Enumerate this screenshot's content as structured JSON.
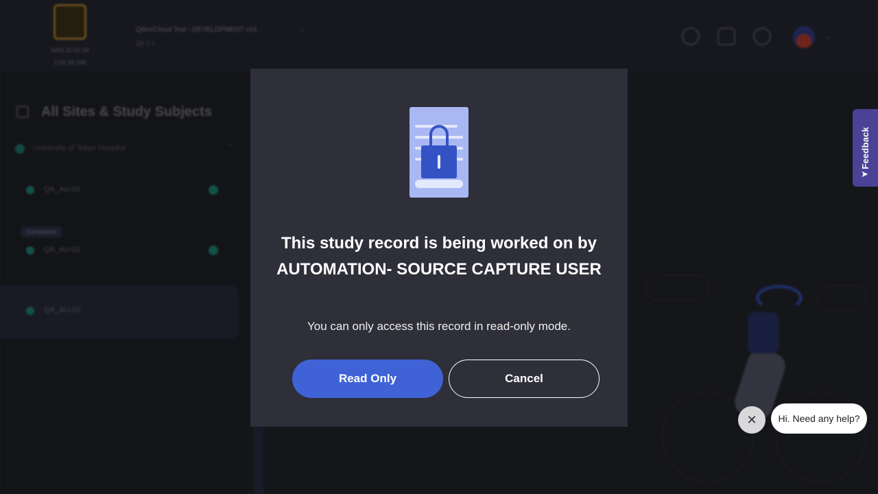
{
  "header": {
    "logo_caption_1": "SAN 11:01:34",
    "logo_caption_2": "1:01:34 GM",
    "study_name": "Qilen/Cloud Test - DEVELOPMENT v16",
    "study_sub": "Qtr 1.1",
    "icons": [
      "search-icon",
      "bell-icon",
      "help-icon"
    ]
  },
  "sidebar": {
    "title": "All Sites & Study Subjects",
    "site_name": "University of Tokyo Hospital",
    "subjects": [
      {
        "label": "QA_AU-01",
        "active": false
      },
      {
        "label": "QA_AU-02",
        "active": false,
        "badge": "Completed"
      },
      {
        "label": "QA_AU-03",
        "active": true
      }
    ]
  },
  "feedback": {
    "label": "Feedback"
  },
  "modal": {
    "title": "This study record is being worked on by AUTOMATION- SOURCE CAPTURE USER",
    "message": "You can only access this record in read-only mode.",
    "primary_label": "Read Only",
    "secondary_label": "Cancel",
    "icon": "document-lock-icon"
  },
  "chat": {
    "greeting": "Hi. Need any help?",
    "close_symbol": "✕"
  },
  "colors": {
    "primary_button": "#3f63d6",
    "modal_bg": "#2e2f38",
    "feedback_tab": "#4b4296"
  }
}
